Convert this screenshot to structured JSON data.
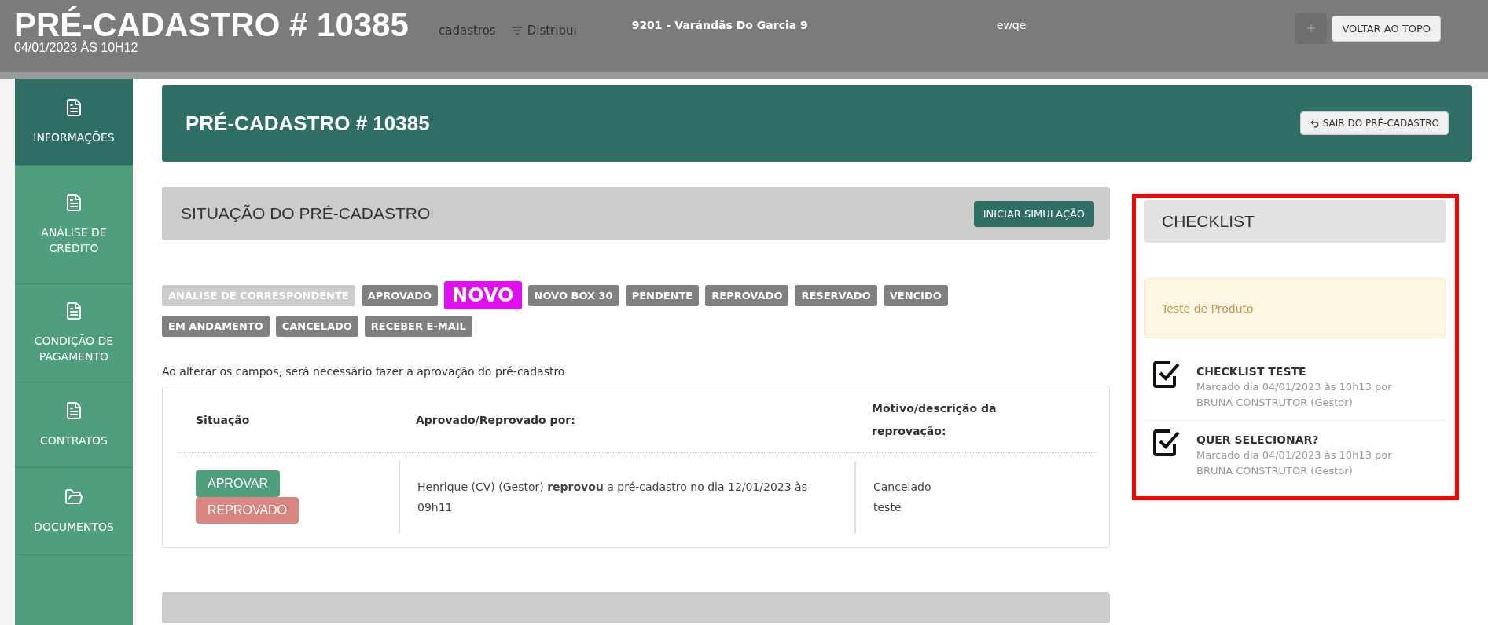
{
  "top_bar": {
    "title": "PRÉ-CADASTRO # 10385",
    "subtitle": "04/01/2023 ÀS 10H12",
    "nav_items": [
      "cadastros",
      "Distribui"
    ],
    "project": "9201 - Varándãs Do Garcia 9",
    "user": "ewqe",
    "back_button": "VOLTAR AO TOPO"
  },
  "sidebar": {
    "items": [
      {
        "label": "INFORMAÇÕES",
        "kind": "file",
        "selected": true
      },
      {
        "label": "ANÁLISE DE CRÉDITO",
        "kind": "file",
        "selected": false
      },
      {
        "label": "CONDIÇÃO DE PAGAMENTO",
        "kind": "file",
        "selected": false
      },
      {
        "label": "CONTRATOS",
        "kind": "file",
        "selected": false
      },
      {
        "label": "DOCUMENTOS",
        "kind": "folder",
        "selected": false
      }
    ]
  },
  "header": {
    "title": "PRÉ-CADASTRO # 10385",
    "exit_button": "SAIR DO PRÉ-CADASTRO"
  },
  "status_panel": {
    "title": "SITUAÇÃO DO PRÉ-CADASTRO",
    "simulate_button": "INICIAR SIMULAÇÃO",
    "tags": [
      {
        "label": "ANÁLISE DE CORRESPONDENTE",
        "color": "#cccccc",
        "emphasized": false
      },
      {
        "label": "APROVADO",
        "color": "#808080",
        "emphasized": false
      },
      {
        "label": "NOVO",
        "color": "#df10ef",
        "emphasized": true
      },
      {
        "label": "NOVO BOX 30",
        "color": "#808080",
        "emphasized": false
      },
      {
        "label": "PENDENTE",
        "color": "#808080",
        "emphasized": false
      },
      {
        "label": "REPROVADO",
        "color": "#808080",
        "emphasized": false
      },
      {
        "label": "RESERVADO",
        "color": "#808080",
        "emphasized": false
      },
      {
        "label": "VENCIDO",
        "color": "#808080",
        "emphasized": false
      },
      {
        "label": "EM ANDAMENTO",
        "color": "#808080",
        "emphasized": false
      },
      {
        "label": "CANCELADO",
        "color": "#808080",
        "emphasized": false
      },
      {
        "label": "RECEBER E-MAIL",
        "color": "#808080",
        "emphasized": false
      }
    ],
    "note": "Ao alterar os campos, será necessário fazer a aprovação do pré-cadastro",
    "table": {
      "columns": [
        "Situação",
        "Aprovado/Reprovado por:",
        "Motivo/descrição da reprovação:"
      ],
      "row": {
        "buttons": [
          {
            "label": "APROVAR",
            "kind": "approve"
          },
          {
            "label": "REPROVADO",
            "kind": "reject"
          }
        ],
        "approver": "Henrique (CV) (Gestor) **reprovou** a pré-cadastro no dia 12/01/2023 às 09h11",
        "reason_lines": [
          "Cancelado",
          "teste"
        ]
      }
    }
  },
  "checklist": {
    "title": "CHECKLIST",
    "highlighted": true,
    "notice": "Teste de Produto",
    "items": [
      {
        "title": "CHECKLIST TESTE",
        "checked": true,
        "meta": "Marcado dia 04/01/2023 às 10h13 por BRUNA CONSTRUTOR (Gestor)"
      },
      {
        "title": "QUER SELECIONAR?",
        "checked": true,
        "meta": "Marcado dia 04/01/2023 às 10h13 por BRUNA CONSTRUTOR (Gestor)"
      }
    ]
  }
}
